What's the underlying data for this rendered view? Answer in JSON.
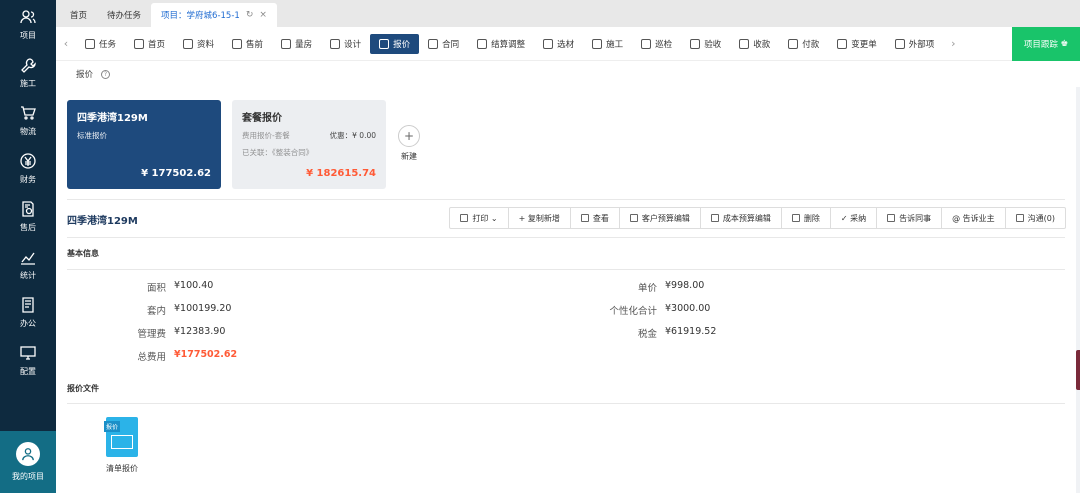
{
  "sidebar": {
    "items": [
      {
        "label": "项目",
        "icon": "user-group-icon"
      },
      {
        "label": "施工",
        "icon": "wrench-icon"
      },
      {
        "label": "物流",
        "icon": "cart-icon"
      },
      {
        "label": "财务",
        "icon": "yen-icon"
      },
      {
        "label": "售后",
        "icon": "document-gear-icon"
      },
      {
        "label": "统计",
        "icon": "bar-chart-icon"
      },
      {
        "label": "办公",
        "icon": "doc-list-icon"
      },
      {
        "label": "配置",
        "icon": "monitor-icon"
      }
    ],
    "me_label": "我的项目"
  },
  "tabs": [
    {
      "label": "首页"
    },
    {
      "label": "待办任务"
    },
    {
      "label": "项目：学府城6-15-1",
      "active": true
    }
  ],
  "modnav": {
    "items": [
      "任务",
      "首页",
      "资料",
      "售前",
      "量房",
      "设计",
      "报价",
      "合同",
      "结算调整",
      "选材",
      "施工",
      "巡检",
      "验收",
      "收款",
      "付款",
      "变更单",
      "外部项"
    ],
    "active_index": 6,
    "track_button": "项目跟踪"
  },
  "breadcrumb": {
    "label": "报价"
  },
  "cards": {
    "standard": {
      "title": "四季港湾129M",
      "subtitle": "标准报价",
      "price": "¥ 177502.62"
    },
    "package": {
      "title": "套餐报价",
      "fee_label": "费用报价-套餐",
      "discount": "优惠：¥ 0.00",
      "linked": "已关联：《整装合同》",
      "price": "¥ 182615.74"
    },
    "new_label": "新建"
  },
  "quote_title": "四季港湾129M",
  "actions": [
    "打印",
    "复制新增",
    "查看",
    "客户预算编辑",
    "成本预算编辑",
    "删除",
    "采纳",
    "告诉同事",
    "告诉业主",
    "沟通(0)"
  ],
  "basic": {
    "section": "基本信息",
    "left": [
      {
        "label": "面积",
        "value": "¥100.40"
      },
      {
        "label": "套内",
        "value": "¥100199.20"
      },
      {
        "label": "管理费",
        "value": "¥12383.90"
      },
      {
        "label": "总费用",
        "value": "¥177502.62",
        "highlight": true
      }
    ],
    "right": [
      {
        "label": "单价",
        "value": "¥998.00"
      },
      {
        "label": "个性化合计",
        "value": "¥3000.00"
      },
      {
        "label": "税金",
        "value": "¥61919.52"
      }
    ]
  },
  "files": {
    "section": "报价文件",
    "items": [
      {
        "name": "清单报价",
        "tag": "报价"
      }
    ]
  },
  "colors": {
    "sidebar": "#0e2a3f",
    "accent": "#1e4a7d",
    "green": "#19c46a",
    "price": "#ff5a36"
  }
}
